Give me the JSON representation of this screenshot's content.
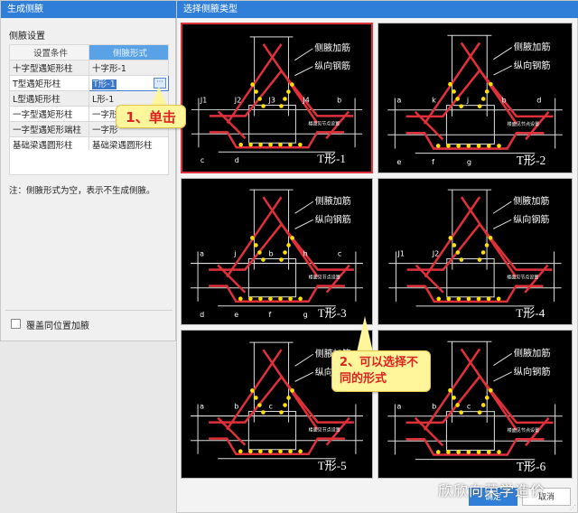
{
  "left_dialog": {
    "title": "生成侧腋",
    "section": "侧腋设置",
    "columns": [
      "设置条件",
      "侧腋形式"
    ],
    "rows": [
      {
        "condition": "十字型遇矩形柱",
        "form": "十字形-1"
      },
      {
        "condition": "T型遇矩形柱",
        "form": "T形-1"
      },
      {
        "condition": "L型遇矩形柱",
        "form": "L形-1"
      },
      {
        "condition": "一字型遇矩形柱",
        "form": "一字形"
      },
      {
        "condition": "一字型遇矩形端柱",
        "form": "一字形"
      },
      {
        "condition": "基础梁遇圆形柱",
        "form": "基础梁遇圆形柱"
      }
    ],
    "browse_button": "···",
    "note": "注：侧腋形式为空，表示不生成侧腋。",
    "checkbox_label": "覆盖同位置加腋",
    "checkbox_checked": false
  },
  "right_dialog": {
    "title": "选择侧腋类型",
    "panels": [
      {
        "label": "T形-1",
        "selected": true,
        "dims": [
          "J1",
          "J2",
          "J3",
          "J4",
          "b",
          "c",
          "d"
        ]
      },
      {
        "label": "T形-2",
        "selected": false,
        "dims": [
          "a",
          "k",
          "j",
          "b",
          "d",
          "e",
          "f",
          "g"
        ]
      },
      {
        "label": "T形-3",
        "selected": false,
        "dims": [
          "a",
          "j",
          "b",
          "h",
          "c",
          "d",
          "e",
          "f",
          "g"
        ]
      },
      {
        "label": "T形-4",
        "selected": false,
        "dims": [
          "J1",
          "J2"
        ]
      },
      {
        "label": "T形-5",
        "selected": false,
        "dims": [
          "a",
          "b",
          "c"
        ]
      },
      {
        "label": "T形-6",
        "selected": false,
        "dims": [
          "a",
          "b",
          "c"
        ]
      }
    ],
    "annotation_haunch": "侧腋加筋",
    "annotation_long": "纵向钢筋",
    "annotation_node": "楼面见节点设置",
    "ok": "确定",
    "cancel": "取消"
  },
  "callouts": {
    "step1": "1、单击",
    "step2": "2、可以选择不同的形式"
  },
  "watermark": "欣欣向荣学造价",
  "colors": {
    "titlebar": "#2f7ed8",
    "rebar": "#e0303a",
    "bars": "#ffe000",
    "callout": "#fff59a"
  }
}
